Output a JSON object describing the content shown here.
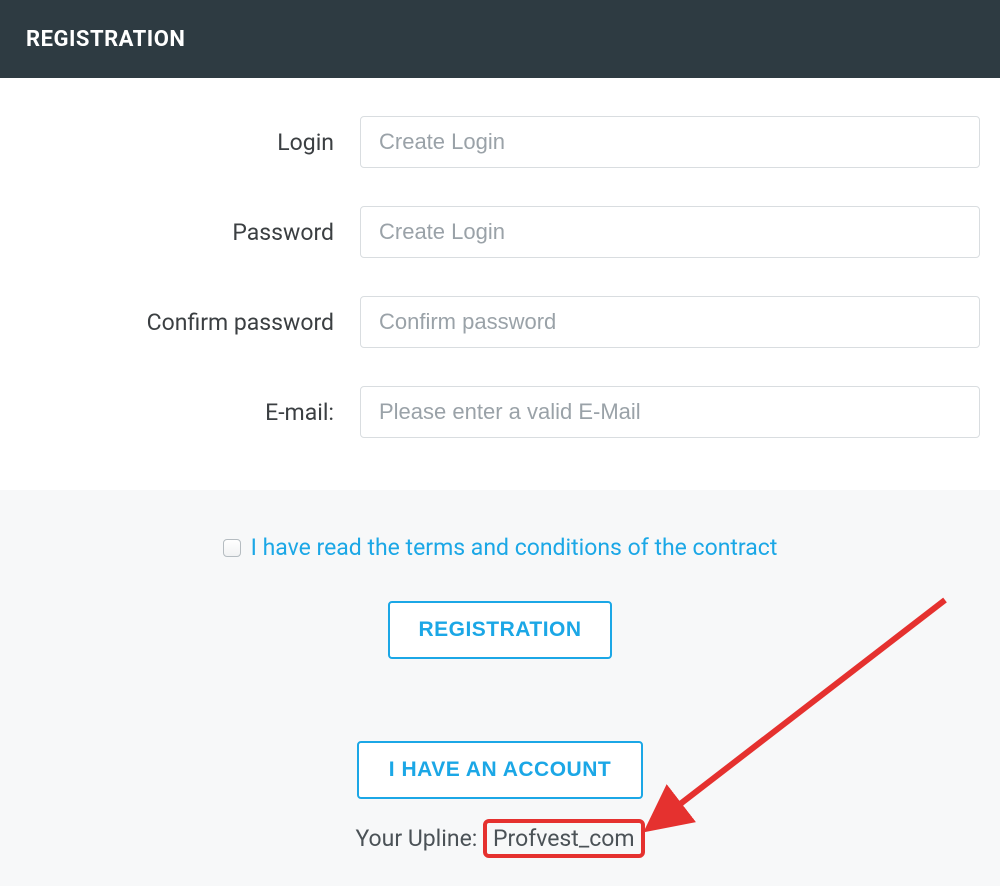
{
  "header": {
    "title": "REGISTRATION"
  },
  "form": {
    "login": {
      "label": "Login",
      "placeholder": "Create Login"
    },
    "password": {
      "label": "Password",
      "placeholder": "Create Login"
    },
    "confirm": {
      "label": "Confirm password",
      "placeholder": "Confirm password"
    },
    "email": {
      "label": "E-mail:",
      "placeholder": "Please enter a valid E-Mail"
    }
  },
  "terms": {
    "link_text": "I have read the terms and conditions of the contract",
    "checked": false
  },
  "buttons": {
    "register": "REGISTRATION",
    "have_account": "I HAVE AN ACCOUNT"
  },
  "upline": {
    "label": "Your Upline: ",
    "value": "Profvest_com"
  },
  "colors": {
    "header_bg": "#2e3b42",
    "accent": "#1ba7e6",
    "annotation": "#e5312f"
  }
}
